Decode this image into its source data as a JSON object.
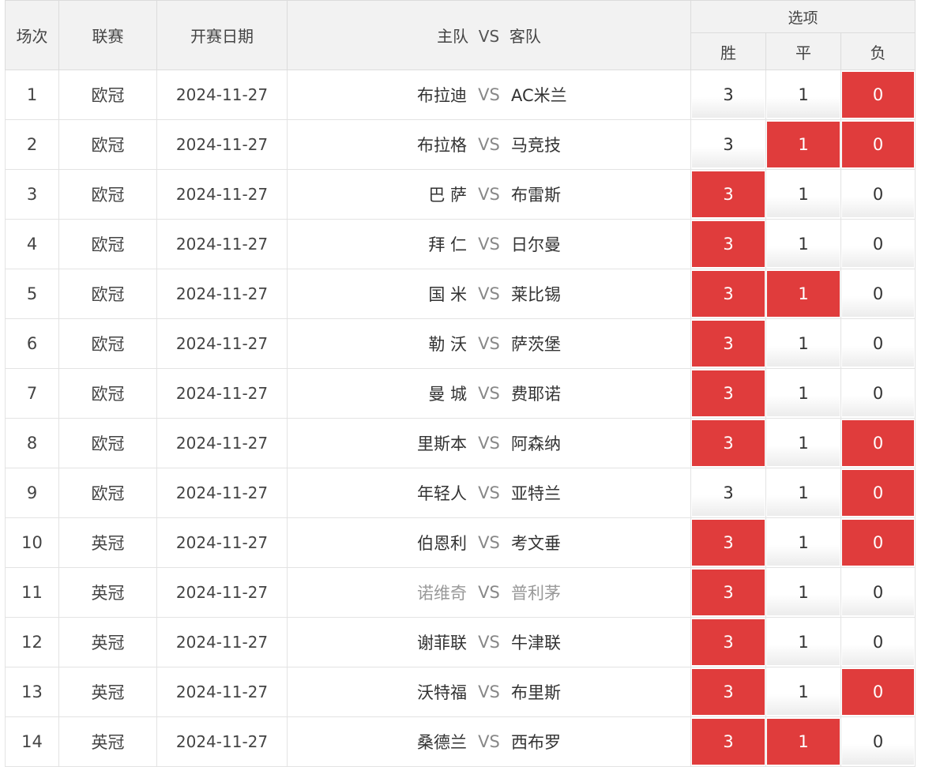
{
  "header": {
    "index": "场次",
    "league": "联赛",
    "date": "开赛日期",
    "home_label": "主队",
    "vs_label": "VS",
    "away_label": "客队",
    "options": "选项",
    "win": "胜",
    "draw": "平",
    "lose": "负"
  },
  "colors": {
    "selected": "#e03c3c",
    "header_bg": "#f2f2f2"
  },
  "rows": [
    {
      "no": "1",
      "league": "欧冠",
      "date": "2024-11-27",
      "home": "布拉迪",
      "vs": "VS",
      "away": "AC米兰",
      "win": "3",
      "draw": "1",
      "lose": "0",
      "sel": [
        false,
        false,
        true
      ]
    },
    {
      "no": "2",
      "league": "欧冠",
      "date": "2024-11-27",
      "home": "布拉格",
      "vs": "VS",
      "away": "马竞技",
      "win": "3",
      "draw": "1",
      "lose": "0",
      "sel": [
        false,
        true,
        true
      ]
    },
    {
      "no": "3",
      "league": "欧冠",
      "date": "2024-11-27",
      "home": "巴 萨",
      "vs": "VS",
      "away": "布雷斯",
      "win": "3",
      "draw": "1",
      "lose": "0",
      "sel": [
        true,
        false,
        false
      ]
    },
    {
      "no": "4",
      "league": "欧冠",
      "date": "2024-11-27",
      "home": "拜 仁",
      "vs": "VS",
      "away": "日尔曼",
      "win": "3",
      "draw": "1",
      "lose": "0",
      "sel": [
        true,
        false,
        false
      ]
    },
    {
      "no": "5",
      "league": "欧冠",
      "date": "2024-11-27",
      "home": "国 米",
      "vs": "VS",
      "away": "莱比锡",
      "win": "3",
      "draw": "1",
      "lose": "0",
      "sel": [
        true,
        true,
        false
      ]
    },
    {
      "no": "6",
      "league": "欧冠",
      "date": "2024-11-27",
      "home": "勒 沃",
      "vs": "VS",
      "away": "萨茨堡",
      "win": "3",
      "draw": "1",
      "lose": "0",
      "sel": [
        true,
        false,
        false
      ]
    },
    {
      "no": "7",
      "league": "欧冠",
      "date": "2024-11-27",
      "home": "曼 城",
      "vs": "VS",
      "away": "费耶诺",
      "win": "3",
      "draw": "1",
      "lose": "0",
      "sel": [
        true,
        false,
        false
      ]
    },
    {
      "no": "8",
      "league": "欧冠",
      "date": "2024-11-27",
      "home": "里斯本",
      "vs": "VS",
      "away": "阿森纳",
      "win": "3",
      "draw": "1",
      "lose": "0",
      "sel": [
        true,
        false,
        true
      ]
    },
    {
      "no": "9",
      "league": "欧冠",
      "date": "2024-11-27",
      "home": "年轻人",
      "vs": "VS",
      "away": "亚特兰",
      "win": "3",
      "draw": "1",
      "lose": "0",
      "sel": [
        false,
        false,
        true
      ]
    },
    {
      "no": "10",
      "league": "英冠",
      "date": "2024-11-27",
      "home": "伯恩利",
      "vs": "VS",
      "away": "考文垂",
      "win": "3",
      "draw": "1",
      "lose": "0",
      "sel": [
        true,
        false,
        true
      ]
    },
    {
      "no": "11",
      "league": "英冠",
      "date": "2024-11-27",
      "home": "诺维奇",
      "vs": "VS",
      "away": "普利茅",
      "win": "3",
      "draw": "1",
      "lose": "0",
      "sel": [
        true,
        false,
        false
      ],
      "dim": true
    },
    {
      "no": "12",
      "league": "英冠",
      "date": "2024-11-27",
      "home": "谢菲联",
      "vs": "VS",
      "away": "牛津联",
      "win": "3",
      "draw": "1",
      "lose": "0",
      "sel": [
        true,
        false,
        false
      ]
    },
    {
      "no": "13",
      "league": "英冠",
      "date": "2024-11-27",
      "home": "沃特福",
      "vs": "VS",
      "away": "布里斯",
      "win": "3",
      "draw": "1",
      "lose": "0",
      "sel": [
        true,
        false,
        true
      ]
    },
    {
      "no": "14",
      "league": "英冠",
      "date": "2024-11-27",
      "home": "桑德兰",
      "vs": "VS",
      "away": "西布罗",
      "win": "3",
      "draw": "1",
      "lose": "0",
      "sel": [
        true,
        true,
        false
      ]
    }
  ]
}
